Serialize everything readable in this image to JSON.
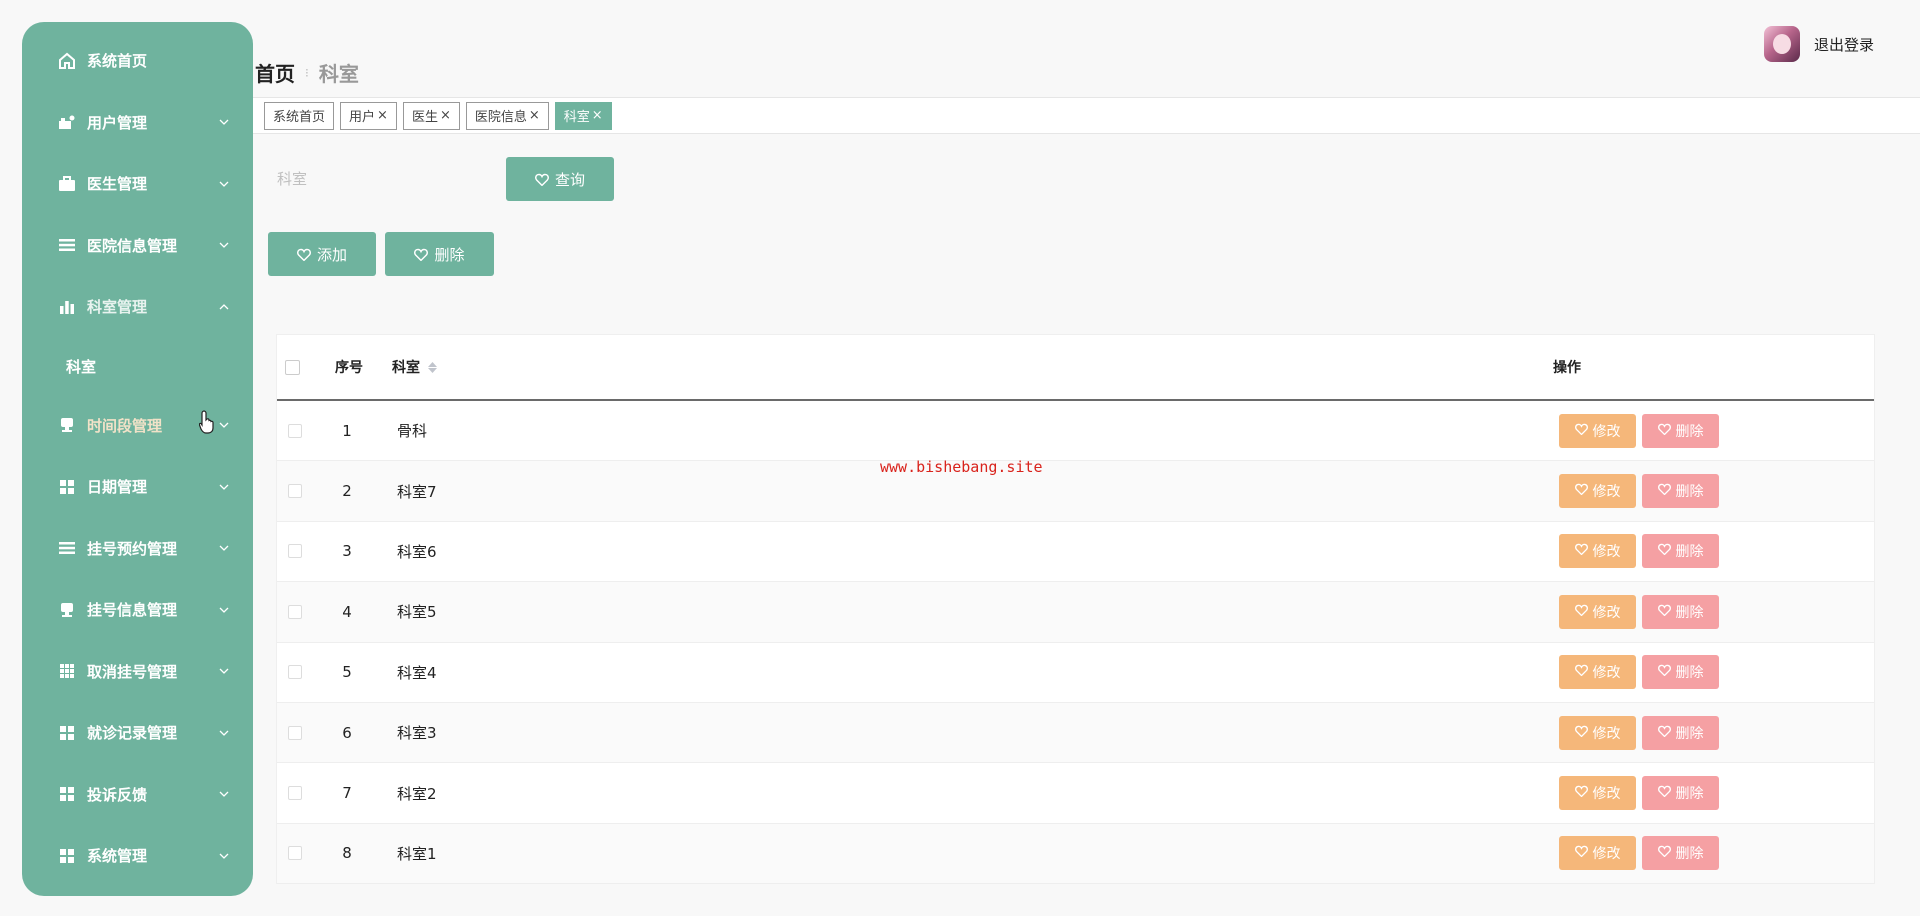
{
  "sidebar": {
    "items": [
      {
        "label": "系统首页",
        "icon": "home-icon",
        "has_children": false
      },
      {
        "label": "用户管理",
        "icon": "users-icon",
        "has_children": true
      },
      {
        "label": "医生管理",
        "icon": "briefcase-icon",
        "has_children": true
      },
      {
        "label": "医院信息管理",
        "icon": "list-icon",
        "has_children": true
      },
      {
        "label": "科室管理",
        "icon": "bar-chart-icon",
        "has_children": true,
        "expanded": true
      },
      {
        "label": "时间段管理",
        "icon": "stamp-icon",
        "has_children": true
      },
      {
        "label": "日期管理",
        "icon": "grid-icon",
        "has_children": true
      },
      {
        "label": "挂号预约管理",
        "icon": "list-icon",
        "has_children": true
      },
      {
        "label": "挂号信息管理",
        "icon": "stamp-icon",
        "has_children": true
      },
      {
        "label": "取消挂号管理",
        "icon": "table-icon",
        "has_children": true
      },
      {
        "label": "就诊记录管理",
        "icon": "grid-icon",
        "has_children": true
      },
      {
        "label": "投诉反馈",
        "icon": "grid-icon",
        "has_children": true
      },
      {
        "label": "系统管理",
        "icon": "grid-icon",
        "has_children": true
      }
    ],
    "sub_item": "科室"
  },
  "header": {
    "breadcrumb_home": "首页",
    "breadcrumb_current": "科室",
    "logout": "退出登录"
  },
  "tags": [
    {
      "label": "系统首页",
      "closable": false,
      "active": false
    },
    {
      "label": "用户",
      "closable": true,
      "active": false
    },
    {
      "label": "医生",
      "closable": true,
      "active": false
    },
    {
      "label": "医院信息",
      "closable": true,
      "active": false
    },
    {
      "label": "科室",
      "closable": true,
      "active": true
    }
  ],
  "search": {
    "placeholder": "科室",
    "value": "",
    "query_label": "查询"
  },
  "actions": {
    "add_label": "添加",
    "delete_label": "删除"
  },
  "table": {
    "headers": {
      "no": "序号",
      "name": "科室",
      "op": "操作"
    },
    "rows": [
      {
        "no": "1",
        "name": "骨科"
      },
      {
        "no": "2",
        "name": "科室7"
      },
      {
        "no": "3",
        "name": "科室6"
      },
      {
        "no": "4",
        "name": "科室5"
      },
      {
        "no": "5",
        "name": "科室4"
      },
      {
        "no": "6",
        "name": "科室3"
      },
      {
        "no": "7",
        "name": "科室2"
      },
      {
        "no": "8",
        "name": "科室1"
      }
    ],
    "edit_label": "修改",
    "remove_label": "删除"
  },
  "watermark": "www.bishebang.site",
  "colors": {
    "primary": "#6fb39e",
    "edit": "#f5b77a",
    "remove": "#f5a0a3",
    "watermark": "#d9231c"
  }
}
